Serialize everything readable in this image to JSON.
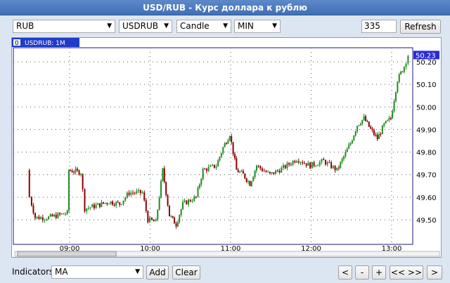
{
  "title": "USD/RUB - Курс доллара к рублю",
  "toolbar": {
    "currency": "RUB",
    "symbol": "USDRUB",
    "chart_type": "Candle",
    "interval": "MIN",
    "count": "335",
    "refresh_label": "Refresh"
  },
  "chart": {
    "tab_marker": "0",
    "tab_label": "USDRUB: 1M",
    "last_price": "50.23",
    "colors": {
      "up": "#228b22",
      "down": "#8b0000",
      "price_box": "#2b2bd6"
    }
  },
  "bottom": {
    "indicators_label": "Indicators",
    "indicator_value": "MA",
    "add_label": "Add",
    "clear_label": "Clear",
    "nav_left": "<",
    "zoom_out": "-",
    "zoom_in": "+",
    "zoom_fit": "<< >>",
    "nav_right": ">"
  },
  "chart_data": {
    "type": "candlestick",
    "title": "USDRUB: 1M",
    "x_ticks": [
      "09:00",
      "10:00",
      "11:00",
      "12:00",
      "13:00"
    ],
    "y_ticks": [
      "49.50",
      "49.60",
      "49.70",
      "49.80",
      "49.90",
      "50.00",
      "50.10",
      "50.20"
    ],
    "ylim": [
      49.4,
      50.25
    ],
    "time_range": [
      "08:29",
      "13:13"
    ],
    "grid": true,
    "last_value": 50.23,
    "close_path": [
      [
        "08:29",
        49.72
      ],
      [
        "08:31",
        49.6
      ],
      [
        "08:35",
        49.51
      ],
      [
        "08:45",
        49.51
      ],
      [
        "08:52",
        49.52
      ],
      [
        "08:59",
        49.53
      ],
      [
        "09:00",
        49.72
      ],
      [
        "09:09",
        49.71
      ],
      [
        "09:12",
        49.55
      ],
      [
        "09:19",
        49.56
      ],
      [
        "09:30",
        49.58
      ],
      [
        "09:38",
        49.57
      ],
      [
        "09:45",
        49.62
      ],
      [
        "09:55",
        49.62
      ],
      [
        "09:59",
        49.5
      ],
      [
        "10:05",
        49.49
      ],
      [
        "10:10",
        49.72
      ],
      [
        "10:15",
        49.52
      ],
      [
        "10:20",
        49.48
      ],
      [
        "10:25",
        49.57
      ],
      [
        "10:35",
        49.6
      ],
      [
        "10:40",
        49.72
      ],
      [
        "10:50",
        49.74
      ],
      [
        "10:55",
        49.82
      ],
      [
        "11:00",
        49.88
      ],
      [
        "11:05",
        49.72
      ],
      [
        "11:10",
        49.7
      ],
      [
        "11:15",
        49.66
      ],
      [
        "11:20",
        49.74
      ],
      [
        "11:30",
        49.7
      ],
      [
        "11:40",
        49.73
      ],
      [
        "11:50",
        49.77
      ],
      [
        "12:00",
        49.74
      ],
      [
        "12:10",
        49.76
      ],
      [
        "12:20",
        49.72
      ],
      [
        "12:25",
        49.78
      ],
      [
        "12:30",
        49.84
      ],
      [
        "12:35",
        49.92
      ],
      [
        "12:40",
        49.95
      ],
      [
        "12:45",
        49.9
      ],
      [
        "12:50",
        49.86
      ],
      [
        "12:55",
        49.92
      ],
      [
        "13:00",
        49.95
      ],
      [
        "13:05",
        50.12
      ],
      [
        "13:10",
        50.18
      ],
      [
        "13:13",
        50.23
      ]
    ]
  }
}
